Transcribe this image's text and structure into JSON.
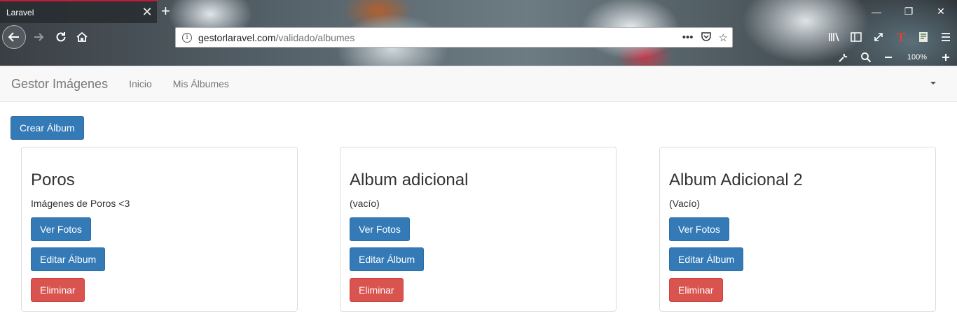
{
  "browser": {
    "tab_title": "Laravel",
    "tab_close": "✕",
    "new_tab": "+",
    "window": {
      "minimize": "—",
      "restore": "❐",
      "close": "✕"
    },
    "url_host": "gestorlaravel.com",
    "url_path": "/validado/albumes",
    "zoom": "100%",
    "url_actions": [
      "more-icon",
      "pocket-icon",
      "bookmark-star-icon"
    ],
    "toolbar_icons": [
      "library-icon",
      "sidebar-icon",
      "fullscreen-icon",
      "extension-t-icon",
      "extension-reader-icon",
      "menu-icon"
    ],
    "toolbar_row2_icons": [
      "wrench-icon",
      "zoom-magnifier-icon",
      "zoom-out-icon",
      "zoom-in-icon"
    ],
    "accent_color": "#c61a3b"
  },
  "navbar": {
    "brand": "Gestor Imágenes",
    "links": [
      "Inicio",
      "Mis Álbumes"
    ]
  },
  "main": {
    "create_button": "Crear Álbum",
    "albums": [
      {
        "title": "Poros",
        "description": "Imágenes de Poros <3",
        "view": "Ver Fotos",
        "edit": "Editar Álbum",
        "delete": "Eliminar"
      },
      {
        "title": "Album adicional",
        "description": "(vacío)",
        "view": "Ver Fotos",
        "edit": "Editar Álbum",
        "delete": "Eliminar"
      },
      {
        "title": "Album Adicional 2",
        "description": "(Vacío)",
        "view": "Ver Fotos",
        "edit": "Editar Álbum",
        "delete": "Eliminar"
      }
    ]
  },
  "colors": {
    "primary": "#337ab7",
    "danger": "#d9534f",
    "navbar_bg": "#f8f8f8"
  }
}
